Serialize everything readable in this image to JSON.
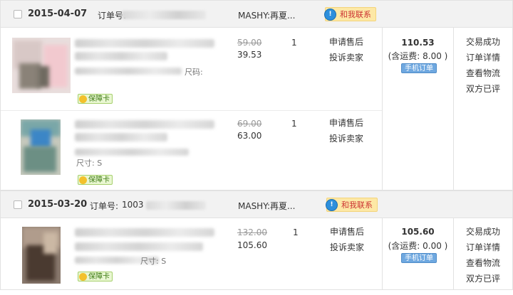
{
  "orders": [
    {
      "date": "2015-04-07",
      "order_no_label": "订单号:",
      "shop": "MASHY:再夏...",
      "contact_label": "和我联系",
      "total": "110.53",
      "shipping": "(含运费: 8.00 )",
      "mobile_label": "手机订单",
      "status_links": [
        "交易成功",
        "订单详情",
        "查看物流",
        "双方已评"
      ],
      "items": [
        {
          "orig_price": "59.00",
          "price": "39.53",
          "qty": "1",
          "size_label": "尺码:",
          "guarantee": "保障卡",
          "after_sale": "申请售后",
          "complain": "投诉卖家"
        },
        {
          "orig_price": "69.00",
          "price": "63.00",
          "qty": "1",
          "size_label": "尺寸: S",
          "guarantee": "保障卡",
          "after_sale": "申请售后",
          "complain": "投诉卖家"
        }
      ]
    },
    {
      "date": "2015-03-20",
      "order_no_label": "订单号:",
      "order_no_prefix": "1003",
      "shop": "MASHY:再夏...",
      "contact_label": "和我联系",
      "total": "105.60",
      "shipping": "(含运费: 0.00 )",
      "mobile_label": "手机订单",
      "status_links": [
        "交易成功",
        "订单详情",
        "查看物流",
        "双方已评"
      ],
      "items": [
        {
          "orig_price": "132.00",
          "price": "105.60",
          "qty": "1",
          "size_label": "尺寸: S",
          "guarantee": "保障卡",
          "after_sale": "申请售后",
          "complain": "投诉卖家"
        }
      ]
    }
  ]
}
